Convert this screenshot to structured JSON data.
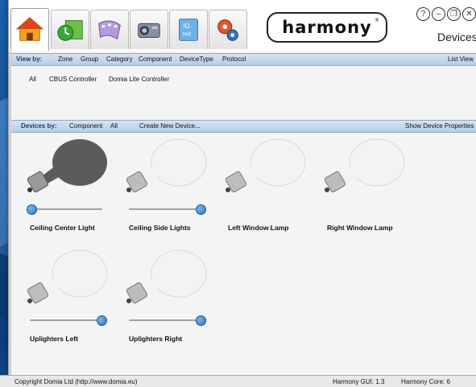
{
  "window": {
    "logo_text": "harmony",
    "screen_title": "Devices",
    "controls": [
      "?",
      "–",
      "❐",
      "✕"
    ]
  },
  "tabs": [
    {
      "name": "home",
      "icon": "home-icon"
    },
    {
      "name": "schedule",
      "icon": "clock-calendar-icon"
    },
    {
      "name": "scenes",
      "icon": "filmstrip-icon"
    },
    {
      "name": "devices",
      "icon": "projector-icon"
    },
    {
      "name": "ir",
      "icon": "ir-net-icon"
    },
    {
      "name": "settings",
      "icon": "gears-icon"
    }
  ],
  "view_bar": {
    "label": "View by:",
    "items": [
      "Zone",
      "Group",
      "Category",
      "Component",
      "DeviceType",
      "Protocol"
    ],
    "right": "List View"
  },
  "filters": [
    "All",
    "CBUS Controller",
    "Domia Lite Controller"
  ],
  "devices_bar": {
    "label": "Devices by:",
    "items": [
      "Component",
      "All"
    ],
    "create": "Create New Device...",
    "right": "Show Device Properties"
  },
  "devices": [
    {
      "label": "Ceiling Center Light",
      "level": 0.0,
      "state": "off"
    },
    {
      "label": "Ceiling Side Lights",
      "level": 1.0,
      "state": "on"
    },
    {
      "label": "Left Window Lamp",
      "state": "on"
    },
    {
      "label": "Right Window Lamp",
      "state": "on"
    },
    {
      "label": "Uplighters Left",
      "level": 1.0,
      "state": "on"
    },
    {
      "label": "Uplighters Right",
      "level": 1.0,
      "state": "on"
    }
  ],
  "status": {
    "copyright": "Copyright Domia Ltd (http://www.domia.eu)",
    "gui": "Harmony GUI: 1.3",
    "core": "Harmony Core: 6"
  },
  "colors": {
    "accent": "#2a6fb8",
    "bar": "#c7d9ee",
    "bulb_off": "#5a5a5a"
  }
}
